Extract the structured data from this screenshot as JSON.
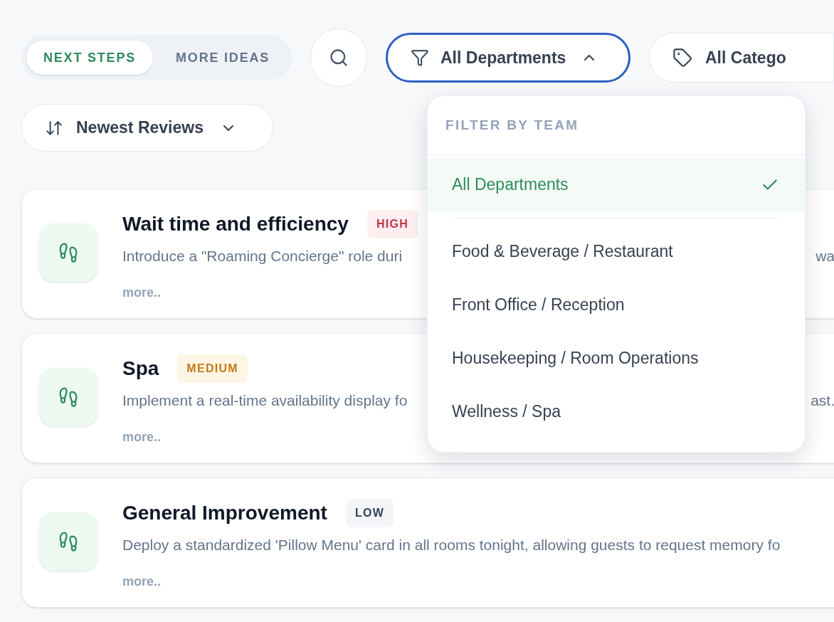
{
  "tabs": [
    {
      "label": "NEXT STEPS",
      "selected": true
    },
    {
      "label": "MORE IDEAS",
      "selected": false
    }
  ],
  "department_filter": {
    "label": "All Departments",
    "expanded": true
  },
  "category_filter": {
    "label": "All Catego"
  },
  "sort": {
    "label": "Newest Reviews"
  },
  "dropdown": {
    "heading": "FILTER BY TEAM",
    "options": [
      {
        "label": "All Departments",
        "selected": true
      },
      {
        "label": "Food & Beverage / Restaurant",
        "selected": false
      },
      {
        "label": "Front Office / Reception",
        "selected": false
      },
      {
        "label": "Housekeeping / Room Operations",
        "selected": false
      },
      {
        "label": "Wellness / Spa",
        "selected": false
      }
    ]
  },
  "cards": [
    {
      "title": "Wait time and efficiency",
      "priority": "HIGH",
      "kind": "high",
      "description": "Introduce a \"Roaming Concierge\" role duri",
      "description_tail": "wa",
      "more": "more.."
    },
    {
      "title": "Spa",
      "priority": "MEDIUM",
      "kind": "medium",
      "description": "Implement a real-time availability display fo",
      "description_tail": "ast.",
      "more": "more.."
    },
    {
      "title": "General Improvement",
      "priority": "LOW",
      "kind": "low",
      "description": "Deploy a standardized 'Pillow Menu' card in all rooms tonight, allowing guests to request memory fo",
      "more": "more.."
    }
  ]
}
